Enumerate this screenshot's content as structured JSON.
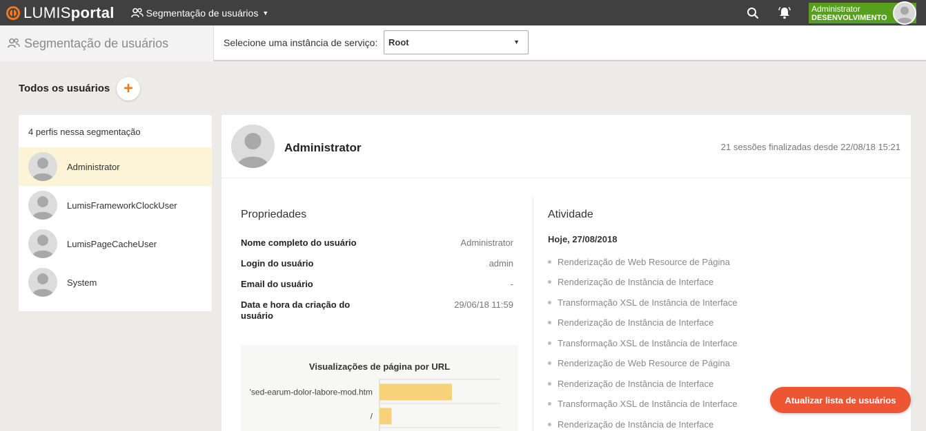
{
  "topbar": {
    "logo_light": "LUMIS",
    "logo_bold": "portal",
    "app_menu_label": "Segmentação de usuários",
    "user_name": "Administrator",
    "user_env": "DESENVOLVIMENTO"
  },
  "subheader": {
    "title": "Segmentação de usuários",
    "instance_label": "Selecione uma instância de serviço:",
    "instance_value": "Root"
  },
  "section": {
    "title": "Todos os usuários",
    "add_label": "+"
  },
  "user_list": {
    "count_label": "4 perfis nessa segmentação",
    "items": [
      {
        "label": "Administrator",
        "selected": true
      },
      {
        "label": "LumisFrameworkClockUser",
        "selected": false
      },
      {
        "label": "LumisPageCacheUser",
        "selected": false
      },
      {
        "label": "System",
        "selected": false
      }
    ]
  },
  "detail": {
    "name": "Administrator",
    "sessions": "21 sessões finalizadas desde 22/08/18 15:21",
    "properties_title": "Propriedades",
    "properties": [
      {
        "label": "Nome completo do usuário",
        "value": "Administrator"
      },
      {
        "label": "Login do usuário",
        "value": "admin"
      },
      {
        "label": "Email do usuário",
        "value": "-"
      },
      {
        "label": "Data e hora da criação do usuário",
        "value": "29/06/18 11:59"
      }
    ],
    "activity_title": "Atividade",
    "activity_date": "Hoje, 27/08/2018",
    "activities": [
      "Renderização de Web Resource de Página",
      "Renderização de Instância de Interface",
      "Transformação XSL de Instância de Interface",
      "Renderização de Instância de Interface",
      "Transformação XSL de Instância de Interface",
      "Renderização de Web Resource de Página",
      "Renderização de Instância de Interface",
      "Transformação XSL de Instância de Interface",
      "Renderização de Instância de Interface"
    ]
  },
  "chart_data": {
    "type": "bar",
    "orientation": "horizontal",
    "title": "Visualizações de página por URL",
    "categories": [
      "'sed-earum-dolor-labore-mod.htm",
      "/"
    ],
    "values": [
      6,
      1
    ],
    "bar_color": "#f8d27a",
    "xlim": [
      0,
      10
    ],
    "grid": true
  },
  "refresh_label": "Atualizar lista de usuários",
  "colors": {
    "topbar": "#404040",
    "accent": "#f07820",
    "user_badge": "#57a01d",
    "selected_row": "#fdf3d6",
    "refresh_button": "#ee5533"
  }
}
